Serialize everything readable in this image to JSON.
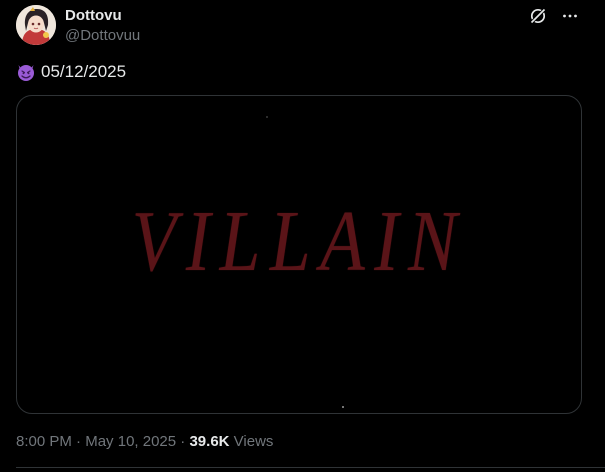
{
  "author": {
    "display_name": "Dottovu",
    "handle": "@Dottovuu",
    "avatar_icon": "avatar-anime-girl"
  },
  "actions": {
    "grok_icon": "grok-icon",
    "more_icon": "more-icon",
    "more_label": "···"
  },
  "tweet": {
    "emoji": "smiling-face-with-horns",
    "text": "05/12/2025"
  },
  "media": {
    "title": "VILLAIN",
    "title_color": "#5a1418"
  },
  "meta": {
    "time": "8:00 PM",
    "separator1": " · ",
    "date": "May 10, 2025",
    "separator2": " · ",
    "views_count": "39.6K",
    "views_label": " Views"
  },
  "colors": {
    "background": "#000000",
    "primary_text": "#e7e9ea",
    "secondary_text": "#71767b",
    "border": "#2f3336",
    "emoji_purple": "#9a5bd6"
  }
}
